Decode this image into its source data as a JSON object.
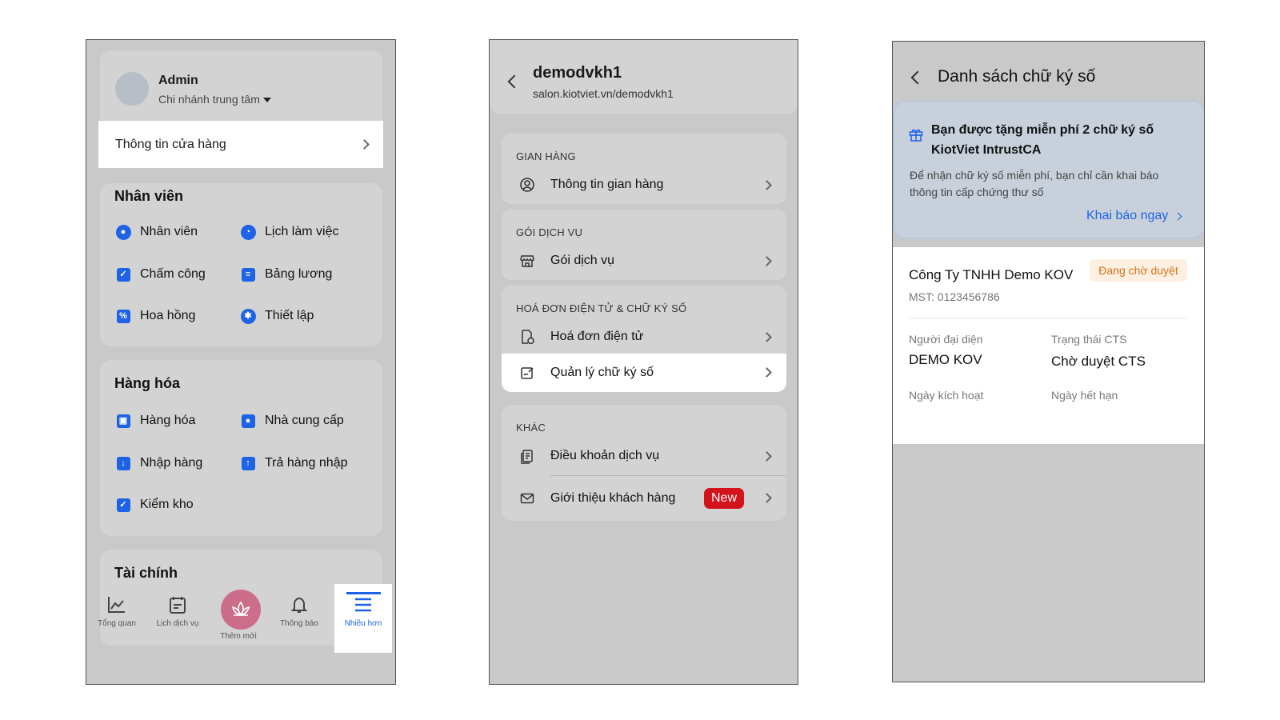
{
  "screen1": {
    "admin_name": "Admin",
    "branch": "Chi nhánh trung tâm",
    "store_info": "Thông tin cửa hàng",
    "staff_section": {
      "title": "Nhân viên",
      "items": [
        {
          "label": "Nhân viên",
          "icon": "user-circle-icon"
        },
        {
          "label": "Lịch làm việc",
          "icon": "clock-icon"
        },
        {
          "label": "Chấm công",
          "icon": "calendar-check-icon"
        },
        {
          "label": "Bảng lương",
          "icon": "list-icon"
        },
        {
          "label": "Hoa hồng",
          "icon": "percent-file-icon"
        },
        {
          "label": "Thiết lập",
          "icon": "gear-icon"
        }
      ]
    },
    "goods_section": {
      "title": "Hàng hóa",
      "items": [
        {
          "label": "Hàng hóa",
          "icon": "box-icon"
        },
        {
          "label": "Nhà cung cấp",
          "icon": "supplier-icon"
        },
        {
          "label": "Nhập hàng",
          "icon": "import-icon"
        },
        {
          "label": "Trả hàng nhập",
          "icon": "return-icon"
        },
        {
          "label": "Kiểm kho",
          "icon": "checkbox-icon"
        }
      ]
    },
    "finance_section": {
      "title": "Tài chính"
    },
    "nav": [
      {
        "label": "Tổng quan",
        "icon": "chart-icon"
      },
      {
        "label": "Lịch dịch vụ",
        "icon": "calendar-icon"
      },
      {
        "label": "Thêm mới",
        "icon": "lotus-icon"
      },
      {
        "label": "Thông báo",
        "icon": "bell-icon"
      },
      {
        "label": "Nhiều hơn",
        "icon": "menu-icon"
      }
    ],
    "accent": "#1e63e6"
  },
  "screen2": {
    "store_name": "demodvkh1",
    "store_url": "salon.kiotviet.vn/demodvkh1",
    "groups": [
      {
        "title": "GIAN HÀNG",
        "rows": [
          {
            "label": "Thông tin gian hàng",
            "icon": "user-circle-outline-icon"
          }
        ]
      },
      {
        "title": "GÓI DỊCH VỤ",
        "rows": [
          {
            "label": "Gói dịch vụ",
            "icon": "store-icon"
          }
        ]
      },
      {
        "title": "HOÁ ĐƠN ĐIỆN TỬ & CHỮ KÝ SỐ",
        "rows": [
          {
            "label": "Hoá đơn điện tử",
            "icon": "invoice-icon"
          },
          {
            "label": "Quản lý chữ ký số",
            "icon": "signature-icon"
          }
        ]
      },
      {
        "title": "KHÁC",
        "rows": [
          {
            "label": "Điều khoản dịch vụ",
            "icon": "document-icon"
          },
          {
            "label": "Giới thiệu khách hàng",
            "icon": "mail-icon",
            "badge": "New"
          }
        ]
      }
    ],
    "badge_color": "#d3121c"
  },
  "screen3": {
    "title": "Danh sách chữ ký số",
    "promo": {
      "title": "Bạn được tặng miễn phí 2 chữ ký số KiotViet IntrustCA",
      "desc": "Để nhận chữ ký số miễn phí, bạn chỉ cần khai báo thông tin cấp chứng thư số",
      "link": "Khai báo ngay"
    },
    "signature": {
      "company": "Công Ty TNHH Demo KOV",
      "status": "Đang chờ duyệt",
      "mst": "MST: 0123456786",
      "rep_label": "Người đại diện",
      "rep_value": "DEMO KOV",
      "cts_label": "Trạng thái CTS",
      "cts_value": "Chờ duyệt CTS",
      "activated_label": "Ngày kích hoạt",
      "expire_label": "Ngày hết hạn"
    },
    "status_color": "#d4731b"
  }
}
